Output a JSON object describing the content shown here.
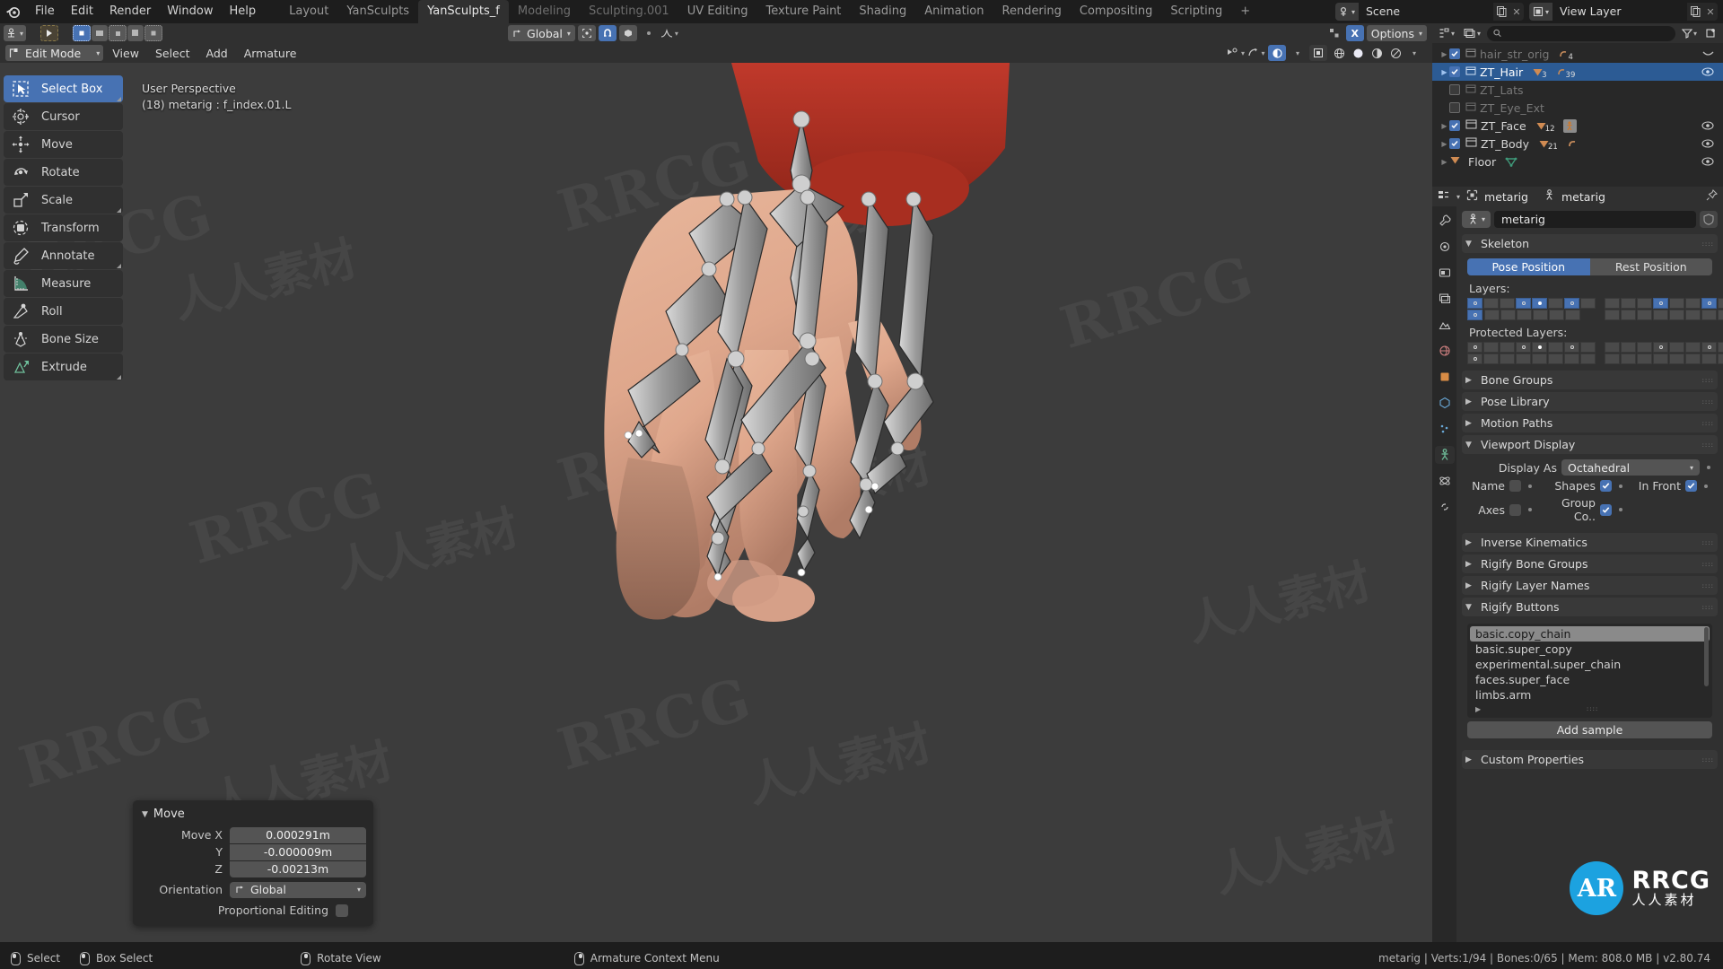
{
  "topbar": {
    "logo_icon": "blender-logo-icon",
    "menus": [
      "File",
      "Edit",
      "Render",
      "Window",
      "Help"
    ],
    "workspace_tabs": [
      {
        "label": "Layout",
        "active": false,
        "dim": false
      },
      {
        "label": "YanSculpts",
        "active": false,
        "dim": false
      },
      {
        "label": "YanSculpts_f",
        "active": true,
        "dim": false
      },
      {
        "label": "Modeling",
        "active": false,
        "dim": true
      },
      {
        "label": "Sculpting.001",
        "active": false,
        "dim": true
      },
      {
        "label": "UV Editing",
        "active": false,
        "dim": false
      },
      {
        "label": "Texture Paint",
        "active": false,
        "dim": false
      },
      {
        "label": "Shading",
        "active": false,
        "dim": false
      },
      {
        "label": "Animation",
        "active": false,
        "dim": false
      },
      {
        "label": "Rendering",
        "active": false,
        "dim": false
      },
      {
        "label": "Compositing",
        "active": false,
        "dim": false
      },
      {
        "label": "Scripting",
        "active": false,
        "dim": false
      },
      {
        "label": "+",
        "active": false,
        "dim": false
      }
    ],
    "scene_name": "Scene",
    "view_layer_name": "View Layer"
  },
  "viewport_header": {
    "editor_type_icon": "editor-type-icon",
    "transform_orientation": "Global",
    "options_label": "Options",
    "xray_label": "X",
    "select_modes": [
      "vertex-select-icon",
      "edge-select-icon",
      "face-select-icon"
    ]
  },
  "viewport_header2": {
    "mode": "Edit Mode",
    "menus": [
      "View",
      "Select",
      "Add",
      "Armature"
    ]
  },
  "viewport": {
    "perspective_label": "User Perspective",
    "object_info": "(18) metarig : f_index.01.L"
  },
  "toolbar": {
    "tools": [
      {
        "label": "Select Box",
        "icon": "select-box-icon",
        "active": true,
        "corner": true
      },
      {
        "label": "Cursor",
        "icon": "cursor-icon",
        "active": false,
        "corner": false
      },
      {
        "label": "Move",
        "icon": "move-icon",
        "active": false,
        "corner": false
      },
      {
        "label": "Rotate",
        "icon": "rotate-icon",
        "active": false,
        "corner": false
      },
      {
        "label": "Scale",
        "icon": "scale-icon",
        "active": false,
        "corner": true
      },
      {
        "label": "Transform",
        "icon": "transform-icon",
        "active": false,
        "corner": false
      },
      {
        "label": "Annotate",
        "icon": "annotate-icon",
        "active": false,
        "corner": true
      },
      {
        "label": "Measure",
        "icon": "measure-icon",
        "active": false,
        "corner": false
      },
      {
        "label": "Roll",
        "icon": "roll-icon",
        "active": false,
        "corner": false
      },
      {
        "label": "Bone Size",
        "icon": "bone-size-icon",
        "active": false,
        "corner": false
      },
      {
        "label": "Extrude",
        "icon": "extrude-icon",
        "active": false,
        "corner": true
      }
    ]
  },
  "operator_panel": {
    "title": "Move",
    "rows": [
      {
        "label": "Move X",
        "value": "0.000291m"
      },
      {
        "label": "Y",
        "value": "-0.000009m"
      },
      {
        "label": "Z",
        "value": "-0.00213m"
      }
    ],
    "orientation_label": "Orientation",
    "orientation_value": "Global",
    "proportional_label": "Proportional Editing",
    "proportional_checked": false
  },
  "outliner": {
    "search_placeholder": "",
    "rows": [
      {
        "name": "hair_str_orig",
        "checked": true,
        "dim": true,
        "expand": true,
        "eye": false,
        "badges": [
          {
            "type": "modifier",
            "count": "4"
          }
        ]
      },
      {
        "name": "ZT_Hair",
        "checked": true,
        "dim": false,
        "expand": true,
        "eye": true,
        "selected": true,
        "badges": [
          {
            "type": "mesh",
            "count": "3"
          },
          {
            "type": "modifier",
            "count": "39"
          }
        ]
      },
      {
        "name": "ZT_Lats",
        "checked": false,
        "dim": true,
        "expand": false,
        "eye": false,
        "badges": []
      },
      {
        "name": "ZT_Eye_Ext",
        "checked": false,
        "dim": true,
        "expand": false,
        "eye": false,
        "badges": []
      },
      {
        "name": "ZT_Face",
        "checked": true,
        "dim": false,
        "expand": true,
        "eye": true,
        "badges": [
          {
            "type": "mesh",
            "count": "12"
          },
          {
            "type": "armature",
            "count": ""
          }
        ]
      },
      {
        "name": "ZT_Body",
        "checked": true,
        "dim": false,
        "expand": true,
        "eye": true,
        "badges": [
          {
            "type": "mesh",
            "count": "21"
          },
          {
            "type": "modifier",
            "count": ""
          }
        ]
      },
      {
        "name": "Floor",
        "checked": null,
        "dim": false,
        "expand": true,
        "eye": true,
        "badges": [
          {
            "type": "meshdata",
            "count": ""
          }
        ]
      }
    ]
  },
  "properties": {
    "breadcrumb": [
      "metarig",
      "metarig"
    ],
    "id_name": "metarig",
    "panels": {
      "skeleton": {
        "title": "Skeleton",
        "pose_position": "Pose Position",
        "rest_position": "Rest Position",
        "pose_active": true,
        "layers_label": "Layers:",
        "protected_label": "Protected Layers:",
        "layers_left_top": [
          true,
          false,
          false,
          true,
          true,
          false,
          true,
          false
        ],
        "layers_left_bottom": [
          true,
          false,
          false,
          false,
          false,
          false,
          false,
          false
        ],
        "layers_right_top": [
          false,
          false,
          false,
          true,
          false,
          false,
          true,
          false
        ],
        "layers_right_bottom": [
          false,
          false,
          false,
          false,
          false,
          false,
          false,
          false
        ]
      },
      "closed_panels_1": [
        "Bone Groups",
        "Pose Library",
        "Motion Paths"
      ],
      "viewport_display": {
        "title": "Viewport Display",
        "display_as_label": "Display As",
        "display_as_value": "Octahedral",
        "name_label": "Name",
        "name_checked": false,
        "shapes_label": "Shapes",
        "shapes_checked": true,
        "in_front_label": "In Front",
        "in_front_checked": true,
        "axes_label": "Axes",
        "axes_checked": false,
        "group_colors_label": "Group Co..",
        "group_colors_checked": true
      },
      "closed_panels_2": [
        "Inverse Kinematics",
        "Rigify Bone Groups",
        "Rigify Layer Names"
      ],
      "rigify_buttons": {
        "title": "Rigify Buttons",
        "items": [
          {
            "label": "basic.copy_chain",
            "selected": true
          },
          {
            "label": "basic.super_copy",
            "selected": false
          },
          {
            "label": "experimental.super_chain",
            "selected": false
          },
          {
            "label": "faces.super_face",
            "selected": false
          },
          {
            "label": "limbs.arm",
            "selected": false
          }
        ],
        "add_sample_label": "Add sample"
      },
      "closed_panels_3": [
        "Custom Properties"
      ]
    },
    "tab_icons": [
      "tool-icon",
      "render-icon",
      "output-icon",
      "view-layer-icon",
      "scene-icon",
      "world-icon",
      "object-icon",
      "modifier-icon",
      "particles-icon",
      "physics-icon",
      "constraint-icon",
      "data-icon",
      "material-icon"
    ]
  },
  "statusbar": {
    "hints": [
      {
        "mouse": "left",
        "label": "Select"
      },
      {
        "mouse": "left-drag",
        "label": "Box Select"
      },
      {
        "mouse": "middle",
        "label": "Rotate View"
      },
      {
        "mouse": "right",
        "label": "Armature Context Menu"
      }
    ],
    "info": "metarig | Verts:1/94 | Bones:0/65 | Mem: 808.0 MB | v2.80.74"
  },
  "watermark": {
    "brand": "RRCG",
    "cn": "人人素材",
    "logo_letters": "AR",
    "logo_title": "RRCG",
    "logo_sub": "人人素材"
  },
  "colors": {
    "accent_blue": "#4772b3",
    "header_gray": "#303030",
    "panel_gray": "#282828",
    "viewport_bg": "#3c3c3c",
    "logo_blue": "#1ca2e0"
  }
}
